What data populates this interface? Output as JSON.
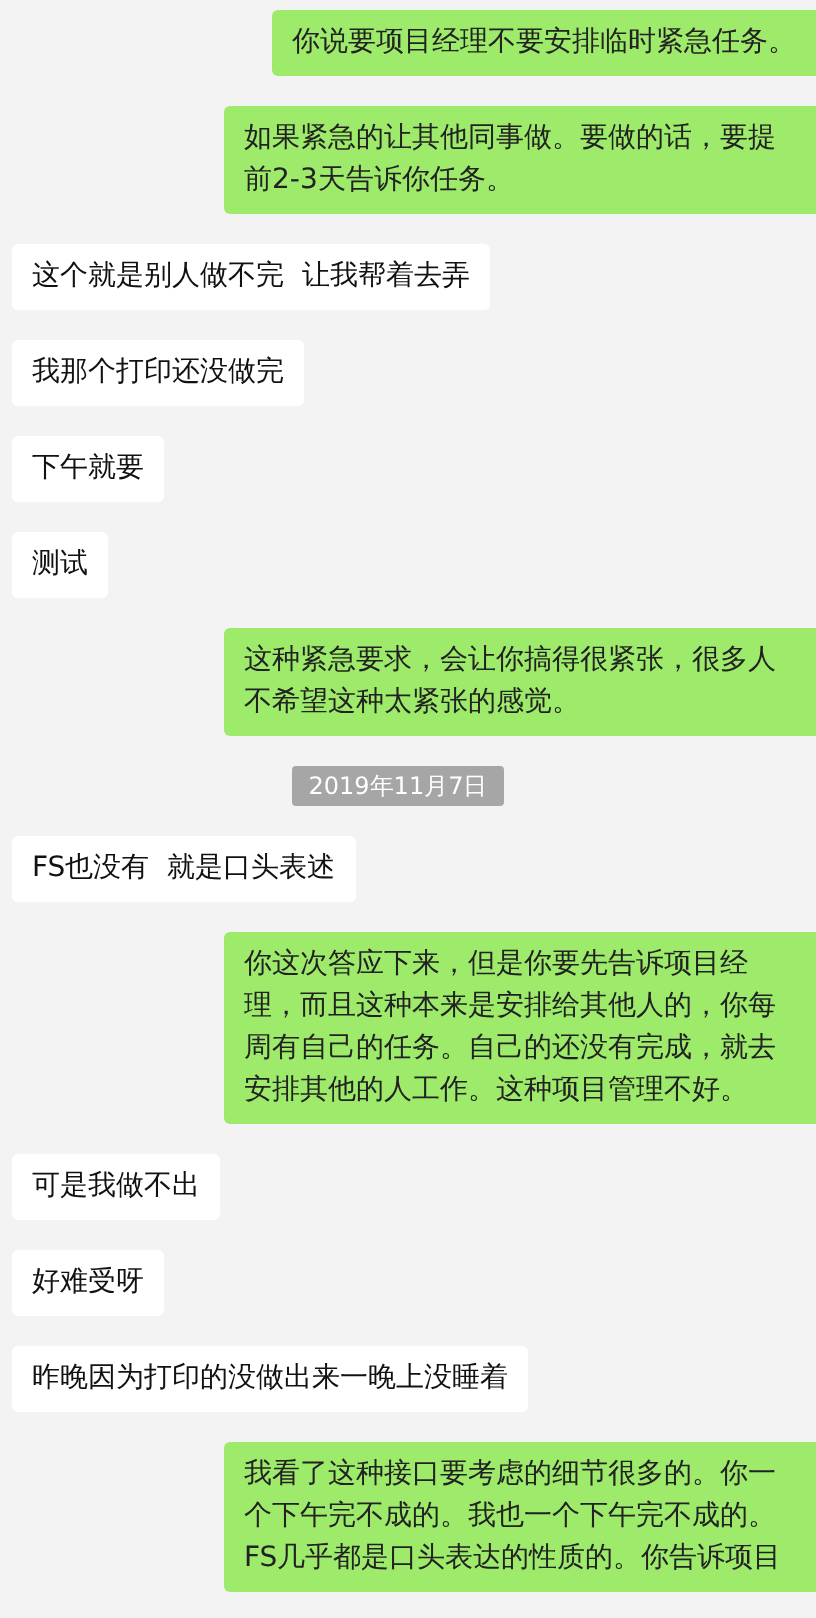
{
  "messages": [
    {
      "kind": "sent",
      "text": "你说要项目经理不要安排临时紧急任务。"
    },
    {
      "kind": "sent",
      "text": "如果紧急的让其他同事做。要做的话，要提前2-3天告诉你任务。"
    },
    {
      "kind": "received",
      "text": "这个就是别人做不完  让我帮着去弄"
    },
    {
      "kind": "received",
      "text": "我那个打印还没做完"
    },
    {
      "kind": "received",
      "text": "下午就要"
    },
    {
      "kind": "received",
      "text": "测试"
    },
    {
      "kind": "sent",
      "text": "这种紧急要求，会让你搞得很紧张，很多人不希望这种太紧张的感觉。"
    },
    {
      "kind": "time",
      "text": "2019年11月7日"
    },
    {
      "kind": "received",
      "text": "FS也没有  就是口头表述"
    },
    {
      "kind": "sent",
      "text": "你这次答应下来，但是你要先告诉项目经理，而且这种本来是安排给其他人的，你每周有自己的任务。自己的还没有完成，就去安排其他的人工作。这种项目管理不好。"
    },
    {
      "kind": "received",
      "text": "可是我做不出"
    },
    {
      "kind": "received",
      "text": "好难受呀"
    },
    {
      "kind": "received",
      "text": "昨晚因为打印的没做出来一晚上没睡着"
    },
    {
      "kind": "sent",
      "text": "我看了这种接口要考虑的细节很多的。你一个下午完不成的。我也一个下午完不成的。FS几乎都是口头表达的性质的。你告诉项目"
    }
  ]
}
